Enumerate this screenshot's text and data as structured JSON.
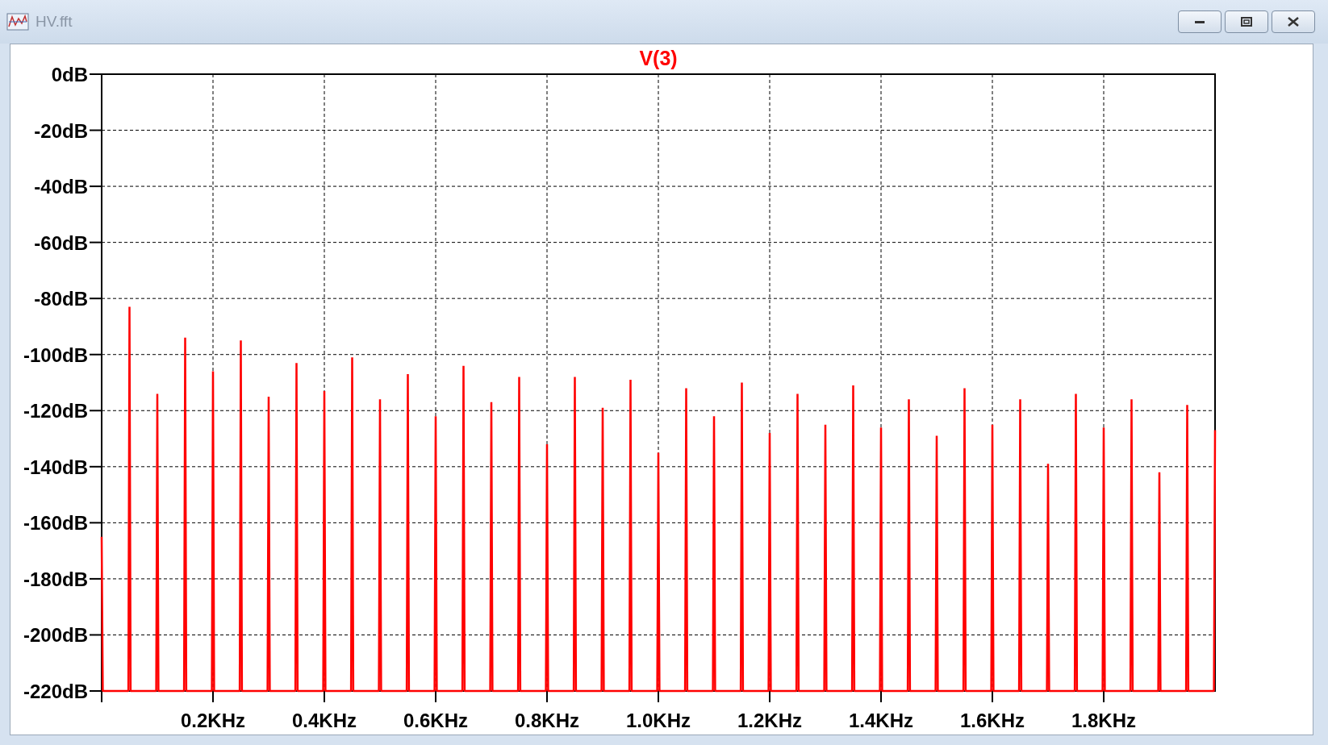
{
  "window": {
    "title": "HV.fft"
  },
  "plot": {
    "chart_data": {
      "type": "line",
      "title": "V(3)",
      "grid": true,
      "x": [
        0,
        0.002,
        0.048,
        0.05,
        0.052,
        0.098,
        0.1,
        0.102,
        0.148,
        0.15,
        0.152,
        0.198,
        0.2,
        0.202,
        0.248,
        0.25,
        0.252,
        0.298,
        0.3,
        0.302,
        0.348,
        0.35,
        0.352,
        0.398,
        0.4,
        0.402,
        0.448,
        0.45,
        0.452,
        0.498,
        0.5,
        0.502,
        0.548,
        0.55,
        0.552,
        0.598,
        0.6,
        0.602,
        0.648,
        0.65,
        0.652,
        0.698,
        0.7,
        0.702,
        0.748,
        0.75,
        0.752,
        0.798,
        0.8,
        0.802,
        0.848,
        0.85,
        0.852,
        0.898,
        0.9,
        0.902,
        0.948,
        0.95,
        0.952,
        0.998,
        1.0,
        1.002,
        1.048,
        1.05,
        1.052,
        1.098,
        1.1,
        1.102,
        1.148,
        1.15,
        1.152,
        1.198,
        1.2,
        1.202,
        1.248,
        1.25,
        1.252,
        1.298,
        1.3,
        1.302,
        1.348,
        1.35,
        1.352,
        1.398,
        1.4,
        1.402,
        1.448,
        1.45,
        1.452,
        1.498,
        1.5,
        1.502,
        1.548,
        1.55,
        1.552,
        1.598,
        1.6,
        1.602,
        1.648,
        1.65,
        1.652,
        1.698,
        1.7,
        1.702,
        1.748,
        1.75,
        1.752,
        1.798,
        1.8,
        1.802,
        1.848,
        1.85,
        1.852,
        1.898,
        1.9,
        1.902,
        1.948,
        1.95,
        1.952,
        1.998,
        2.0
      ],
      "series": [
        {
          "color": "#ff0000",
          "values": [
            -165,
            -220,
            -220,
            -83,
            -220,
            -220,
            -114,
            -220,
            -220,
            -94,
            -220,
            -220,
            -106,
            -220,
            -220,
            -95,
            -220,
            -220,
            -115,
            -220,
            -220,
            -103,
            -220,
            -220,
            -113,
            -220,
            -220,
            -101,
            -220,
            -220,
            -116,
            -220,
            -220,
            -107,
            -220,
            -220,
            -122,
            -220,
            -220,
            -104,
            -220,
            -220,
            -117,
            -220,
            -220,
            -108,
            -220,
            -220,
            -132,
            -220,
            -220,
            -108,
            -220,
            -220,
            -119,
            -220,
            -220,
            -109,
            -220,
            -220,
            -135,
            -220,
            -220,
            -112,
            -220,
            -220,
            -122,
            -220,
            -220,
            -110,
            -220,
            -220,
            -128,
            -220,
            -220,
            -114,
            -220,
            -220,
            -125,
            -220,
            -220,
            -111,
            -220,
            -220,
            -126,
            -220,
            -220,
            -116,
            -220,
            -220,
            -129,
            -220,
            -220,
            -112,
            -220,
            -220,
            -125,
            -220,
            -220,
            -116,
            -220,
            -220,
            -139,
            -220,
            -220,
            -114,
            -220,
            -220,
            -126,
            -220,
            -220,
            -116,
            -220,
            -220,
            -142,
            -220,
            -220,
            -118,
            -220,
            -220,
            -127
          ]
        }
      ],
      "xlim": [
        0,
        2
      ],
      "ylim": [
        -220,
        0
      ],
      "xticks": [
        {
          "value": 0.2,
          "label": "0.2KHz"
        },
        {
          "value": 0.4,
          "label": "0.4KHz"
        },
        {
          "value": 0.6,
          "label": "0.6KHz"
        },
        {
          "value": 0.8,
          "label": "0.8KHz"
        },
        {
          "value": 1.0,
          "label": "1.0KHz"
        },
        {
          "value": 1.2,
          "label": "1.2KHz"
        },
        {
          "value": 1.4,
          "label": "1.4KHz"
        },
        {
          "value": 1.6,
          "label": "1.6KHz"
        },
        {
          "value": 1.8,
          "label": "1.8KHz"
        }
      ],
      "yticks": [
        {
          "value": 0,
          "label": "0dB"
        },
        {
          "value": -20,
          "label": "-20dB"
        },
        {
          "value": -40,
          "label": "-40dB"
        },
        {
          "value": -60,
          "label": "-60dB"
        },
        {
          "value": -80,
          "label": "-80dB"
        },
        {
          "value": -100,
          "label": "-100dB"
        },
        {
          "value": -120,
          "label": "-120dB"
        },
        {
          "value": -140,
          "label": "-140dB"
        },
        {
          "value": -160,
          "label": "-160dB"
        },
        {
          "value": -180,
          "label": "-180dB"
        },
        {
          "value": -200,
          "label": "-200dB"
        },
        {
          "value": -220,
          "label": "-220dB"
        }
      ]
    }
  }
}
